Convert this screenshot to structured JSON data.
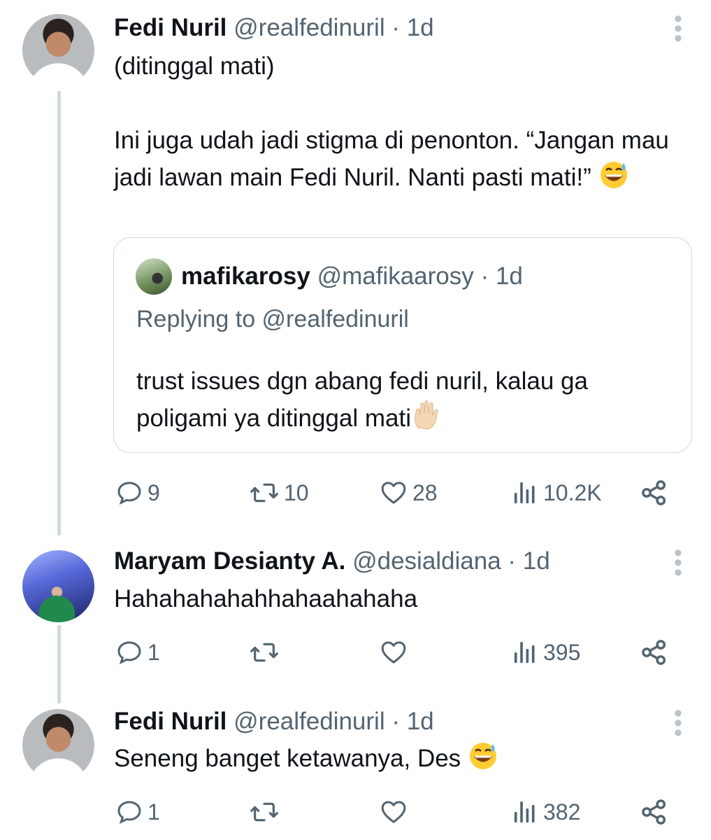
{
  "tweets": [
    {
      "name": "Fedi Nuril",
      "handle": "@realfedinuril · 1d",
      "paragraphs": [
        "(ditinggal mati)",
        "",
        "Ini juga udah jadi stigma di penonton. “Jangan mau jadi lawan main Fedi Nuril. Nanti pasti mati!”"
      ],
      "emoji": "sweat-smile-emoji",
      "quote": {
        "name": "mafikarosy",
        "handle": "@mafikaarosy · 1d",
        "replying_to": "Replying to @realfedinuril",
        "text": "trust issues dgn abang fedi nuril, kalau ga poligami ya ditinggal mati",
        "emoji": "raised-hand-emoji"
      },
      "actions": {
        "replies": "9",
        "retweets": "10",
        "likes": "28",
        "views": "10.2K"
      }
    },
    {
      "name": "Maryam Desianty A.",
      "handle": "@desialdiana · 1d",
      "text": "Hahahahahahhahaahahaha",
      "actions": {
        "replies": "1",
        "retweets": "",
        "likes": "",
        "views": "395"
      }
    },
    {
      "name": "Fedi Nuril",
      "handle": "@realfedinuril · 1d",
      "text": "Seneng banget ketawanya, Des",
      "emoji": "sweat-smile-emoji",
      "actions": {
        "replies": "1",
        "retweets": "",
        "likes": "",
        "views": "382"
      }
    }
  ],
  "icons": {
    "reply": "reply-icon",
    "retweet": "retweet-icon",
    "like": "heart-icon",
    "views": "views-icon",
    "share": "share-icon",
    "more": "more-vertical-icon"
  },
  "colors": {
    "text": "#0f1419",
    "secondary": "#536471",
    "thread_line": "#cfd9de"
  }
}
